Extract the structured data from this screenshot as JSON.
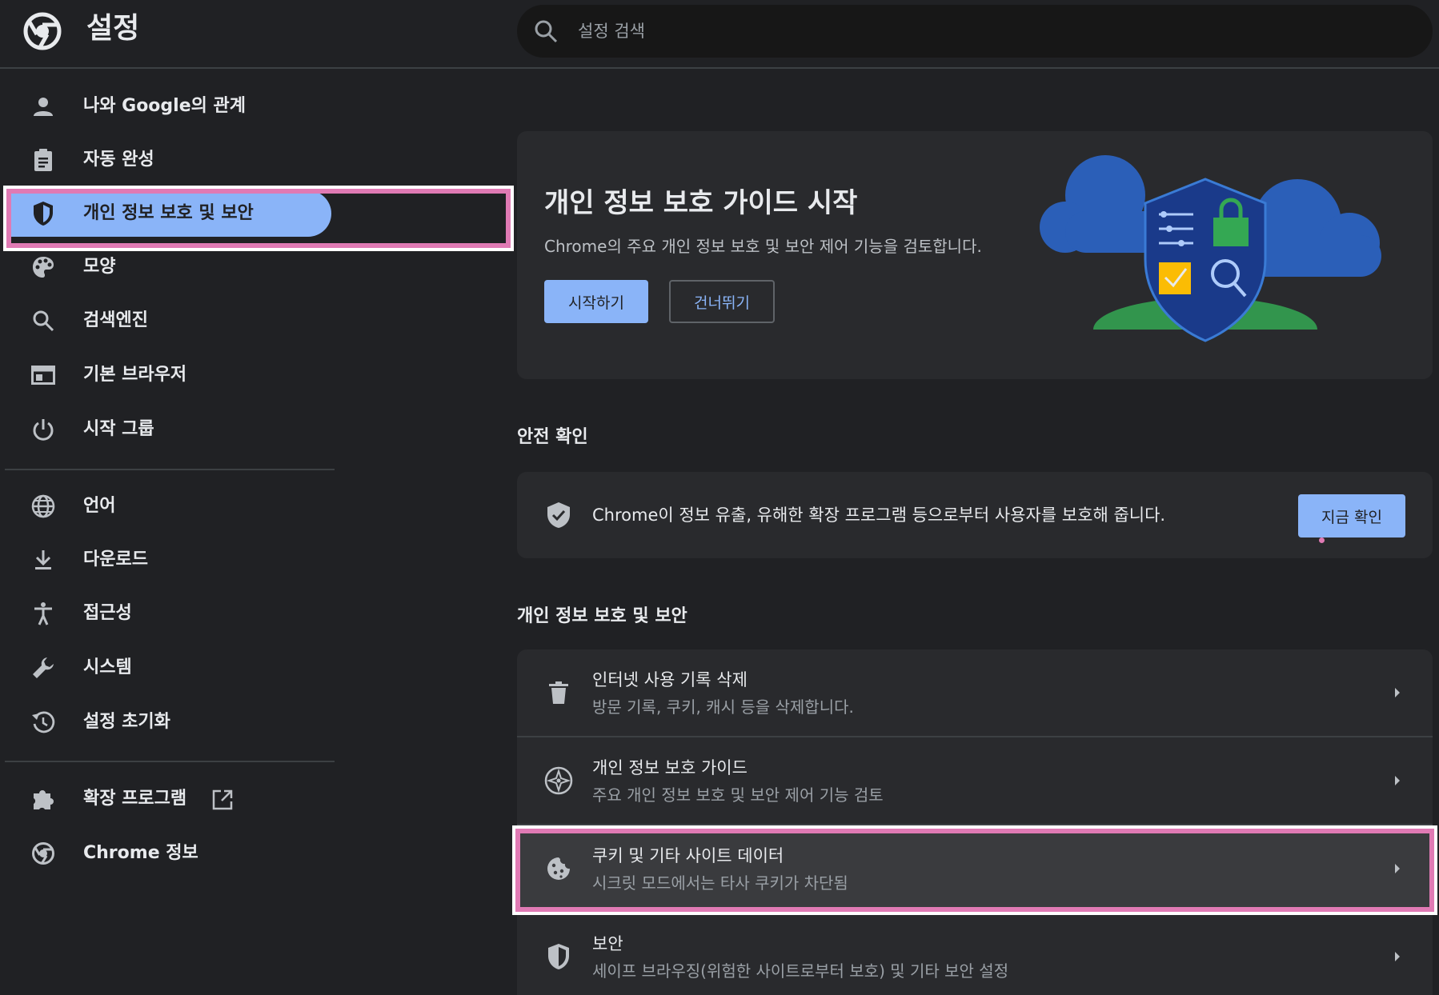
{
  "header": {
    "title": "설정",
    "search_placeholder": "설정 검색",
    "logo_icon": "chrome-logo-icon",
    "search_icon": "search-icon"
  },
  "sidebar": {
    "items": [
      {
        "label": "나와 Google의 관계",
        "icon": "person-icon"
      },
      {
        "label": "자동 완성",
        "icon": "clipboard-icon"
      },
      {
        "label": "개인 정보 보호 및 보안",
        "icon": "shield-icon",
        "active": true
      },
      {
        "label": "모양",
        "icon": "palette-icon"
      },
      {
        "label": "검색엔진",
        "icon": "search-icon"
      },
      {
        "label": "기본 브라우저",
        "icon": "browser-icon"
      },
      {
        "label": "시작 그룹",
        "icon": "power-icon"
      },
      {
        "label": "언어",
        "icon": "globe-icon"
      },
      {
        "label": "다운로드",
        "icon": "download-icon"
      },
      {
        "label": "접근성",
        "icon": "accessibility-icon"
      },
      {
        "label": "시스템",
        "icon": "wrench-icon"
      },
      {
        "label": "설정 초기화",
        "icon": "history-icon"
      },
      {
        "label": "확장 프로그램",
        "icon": "puzzle-icon"
      },
      {
        "label": "Chrome 정보",
        "icon": "chrome-icon"
      }
    ]
  },
  "guide_card": {
    "title": "개인 정보 보호 가이드 시작",
    "description": "Chrome의 주요 개인 정보 보호 및 보안 제어 기능을 검토합니다.",
    "start_label": "시작하기",
    "skip_label": "건너뛰기"
  },
  "safety": {
    "section_title": "안전 확인",
    "text": "Chrome이 정보 유출, 유해한 확장 프로그램 등으로부터 사용자를 보호해 줍니다.",
    "button_label": "지금 확인"
  },
  "privacy": {
    "section_title": "개인 정보 보호 및 보안",
    "rows": [
      {
        "title": "인터넷 사용 기록 삭제",
        "subtitle": "방문 기록, 쿠키, 캐시 등을 삭제합니다.",
        "icon": "trash-icon"
      },
      {
        "title": "개인 정보 보호 가이드",
        "subtitle": "주요 개인 정보 보호 및 보안 제어 기능 검토",
        "icon": "compass-icon"
      },
      {
        "title": "쿠키 및 기타 사이트 데이터",
        "subtitle": "시크릿 모드에서는 타사 쿠키가 차단됨",
        "icon": "cookie-icon"
      },
      {
        "title": "보안",
        "subtitle": "세이프 브라우징(위험한 사이트로부터 보호) 및 기타 보안 설정",
        "icon": "security-shield-icon"
      }
    ]
  },
  "colors": {
    "background": "#202124",
    "card": "#292a2d",
    "accent": "#8ab4f8",
    "highlight": "#e07ab4"
  }
}
